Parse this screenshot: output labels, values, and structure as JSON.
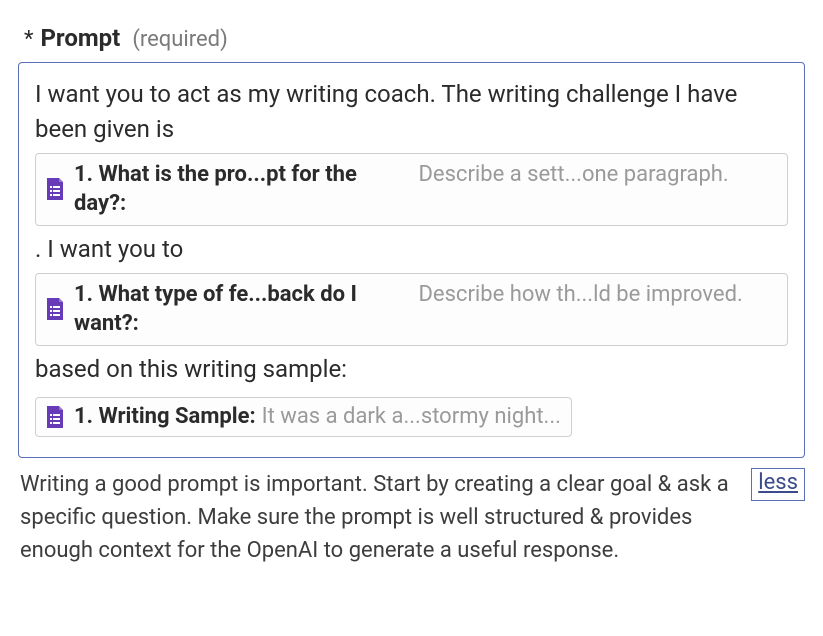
{
  "field": {
    "asterisk": "*",
    "label": "Prompt",
    "required_tag": "(required)"
  },
  "prompt": {
    "text_line_1": "I want you to act as my writing coach. The writing challenge I have been given is",
    "chip_1": {
      "label": "1. What is the pro...pt for the day?:",
      "value": "Describe a sett...one paragraph."
    },
    "text_line_2": ".  I want you to",
    "chip_2": {
      "label": "1. What type of fe...back do I want?:",
      "value": "Describe how th...ld be improved."
    },
    "text_line_3": "based on this writing sample:",
    "chip_3": {
      "label": "1. Writing Sample:",
      "value": "It was a dark a...stormy night..."
    }
  },
  "helper": {
    "text": "Writing a good prompt is important. Start by creating a clear goal & ask a specific question. Make sure the prompt is well structured & provides enough context for the OpenAI to generate a useful response.",
    "less_label": "less"
  }
}
